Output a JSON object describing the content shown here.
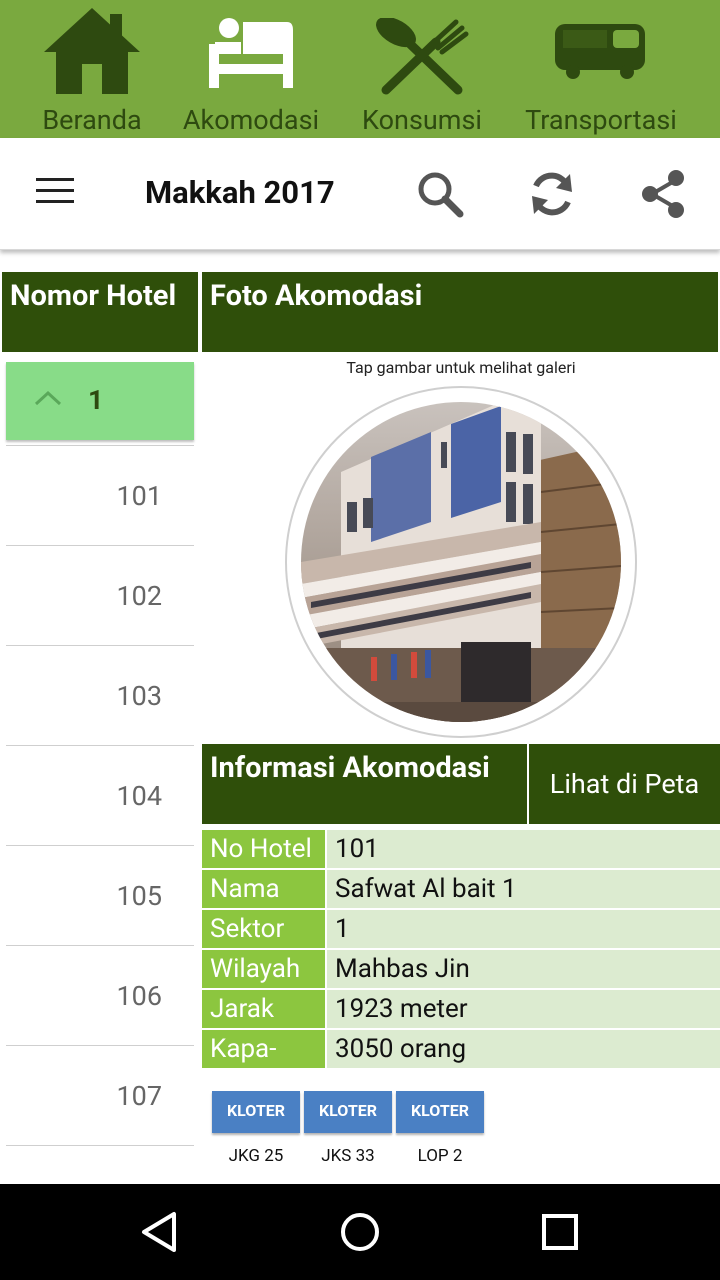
{
  "tabs": [
    {
      "label": "Beranda",
      "icon": "home-icon",
      "active": false
    },
    {
      "label": "Akomodasi",
      "icon": "bed-icon",
      "active": true
    },
    {
      "label": "Konsumsi",
      "icon": "utensils-icon",
      "active": false
    },
    {
      "label": "Transportasi",
      "icon": "bus-icon",
      "active": false
    }
  ],
  "toolbar": {
    "title": "Makkah 2017",
    "actions": [
      "search-icon",
      "refresh-icon",
      "share-icon"
    ]
  },
  "columns": {
    "hotel_number": "Nomor Hotel",
    "photo": "Foto Akomodasi"
  },
  "photo_hint": "Tap gambar untuk melihat galeri",
  "hotel_list": {
    "group": "1",
    "items": [
      "101",
      "102",
      "103",
      "104",
      "105",
      "106",
      "107"
    ]
  },
  "info": {
    "title": "Informasi Akomodasi",
    "map_button": "Lihat di Peta",
    "rows": [
      {
        "key": "No Hotel",
        "value": "101"
      },
      {
        "key": "Nama",
        "value": " Safwat Al bait 1"
      },
      {
        "key": "Sektor",
        "value": "1"
      },
      {
        "key": "Wilayah",
        "value": " Mahbas Jin"
      },
      {
        "key": "Jarak",
        "value": "1923 meter"
      },
      {
        "key": "Kapa-",
        "value": "3050 orang"
      }
    ]
  },
  "kloter": [
    {
      "label": "KLOTER",
      "caption": "JKG 25"
    },
    {
      "label": "KLOTER",
      "caption": "JKS 33"
    },
    {
      "label": "KLOTER",
      "caption": "LOP 2"
    }
  ],
  "colors": {
    "tab_bar": "#7aa93f",
    "header_dark": "#2f4f0a",
    "key_green": "#8cc63f",
    "value_bg": "#dcebd0",
    "selected_item": "#88dc88",
    "kloter_blue": "#4a80c4"
  }
}
